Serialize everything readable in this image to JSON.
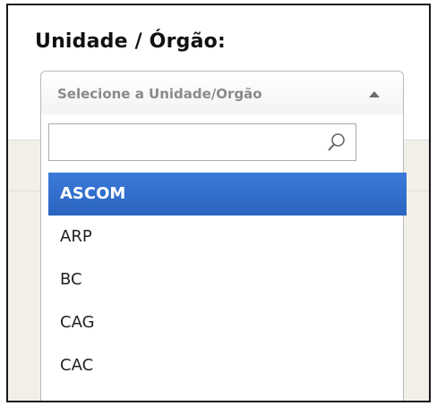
{
  "field": {
    "label": "Unidade / Órgão"
  },
  "select": {
    "selected_text": "Selecione a Unidade/Orgão",
    "expanded": true
  },
  "search": {
    "value": "",
    "placeholder": ""
  },
  "options": [
    {
      "label": "ASCOM",
      "highlighted": true
    },
    {
      "label": "ARP",
      "highlighted": false
    },
    {
      "label": "BC",
      "highlighted": false
    },
    {
      "label": "CAG",
      "highlighted": false
    },
    {
      "label": "CAC",
      "highlighted": false
    }
  ],
  "icons": {
    "search": "search-icon",
    "arrow": "chevron-up-icon"
  },
  "colors": {
    "highlight": "#2f6cc9",
    "background_lower": "#f2efe9"
  }
}
